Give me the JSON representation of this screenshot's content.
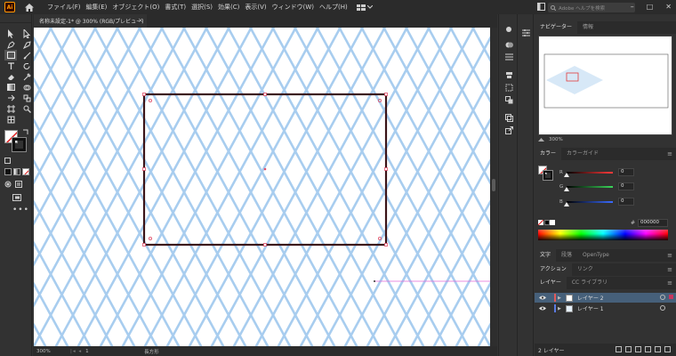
{
  "menubar": {
    "app_badge": "Ai",
    "items": [
      "ファイル(F)",
      "編集(E)",
      "オブジェクト(O)",
      "書式(T)",
      "選択(S)",
      "効果(C)",
      "表示(V)",
      "ウィンドウ(W)",
      "ヘルプ(H)"
    ],
    "search_placeholder": "Adobe ヘルプを検索"
  },
  "document": {
    "tab_title": "名称未設定-1* @ 300% (RGB/プレビュー)",
    "close_glyph": "×"
  },
  "statusbar": {
    "zoom": "300%",
    "nav_glyphs": "|◂ ◂",
    "artboard_number": "1",
    "status_label": "長方形"
  },
  "navigator": {
    "tabs": [
      "ナビゲーター",
      "情報"
    ],
    "zoom": "300%"
  },
  "color_panel": {
    "tabs": [
      "カラー",
      "カラーガイド"
    ],
    "sliders": [
      {
        "label": "R",
        "value": "0",
        "color": "#ff3b3b"
      },
      {
        "label": "G",
        "value": "0",
        "color": "#3bd65a"
      },
      {
        "label": "B",
        "value": "0",
        "color": "#3b6bff"
      }
    ],
    "hex_prefix": "#",
    "hex_value": "000000"
  },
  "type_panel": {
    "tabs": [
      "文字",
      "段落",
      "OpenType"
    ]
  },
  "action_panel": {
    "tabs": [
      "アクション",
      "リンク"
    ]
  },
  "layers_panel": {
    "tabs": [
      "レイヤー",
      "CC ライブラリ"
    ],
    "layers": [
      {
        "name": "レイヤー 2",
        "color": "#e05a5a",
        "selected": true
      },
      {
        "name": "レイヤー 1",
        "color": "#5a7ae0",
        "selected": false
      }
    ],
    "footer_label": "2 レイヤー"
  },
  "colors": {
    "canvas_bg": "#ffffff",
    "grid_line": "#a8cdef",
    "rect_stroke": "#3b1418",
    "selection_handle": "#e0506a",
    "accent": "#46607a"
  }
}
